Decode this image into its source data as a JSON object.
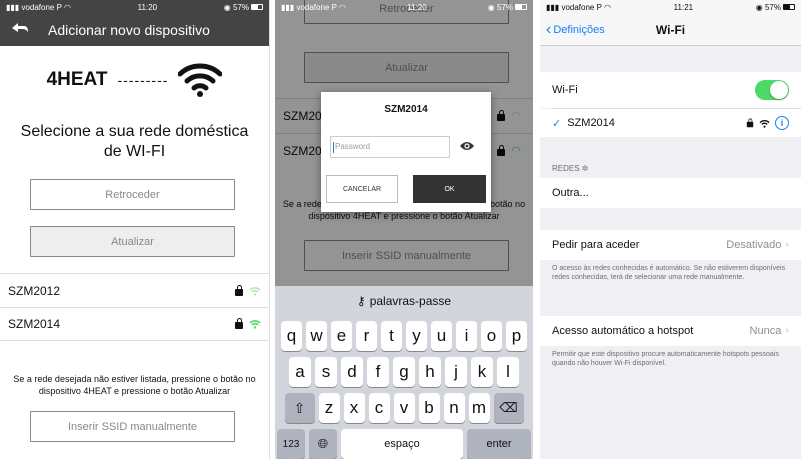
{
  "panel1": {
    "status": {
      "carrier": "vodafone P",
      "time": "11:20",
      "battery": "57%"
    },
    "header_title": "Adicionar novo dispositivo",
    "brand_name": "4HEAT",
    "brand_dashes": "---------",
    "heading": "Selecione a sua rede doméstica de WI-FI",
    "back_button": "Retroceder",
    "update_button": "Atualizar",
    "networks": [
      {
        "name": "SZM2012"
      },
      {
        "name": "SZM2014"
      }
    ],
    "note": "Se a rede desejada não estiver listada, pressione o botão no dispositivo 4HEAT e pressione o botão Atualizar",
    "manual_button": "Inserir SSID manualmente"
  },
  "panel2": {
    "status": {
      "carrier": "vodafone P",
      "time": "11:20",
      "battery": "57%"
    },
    "back_button": "Retroceder",
    "update_button": "Atualizar",
    "networks": [
      {
        "name": "SZM2012"
      },
      {
        "name": "SZM2014"
      }
    ],
    "note": "Se a rede desejada não estiver listada, pressione o botão no dispositivo 4HEAT e pressione o botão Atualizar",
    "manual_button": "Inserir SSID manualmente",
    "dialog": {
      "title": "SZM2014",
      "placeholder": "Password",
      "cancel": "CANCELAR",
      "ok": "OK"
    },
    "keyboard": {
      "suggestion": "palavras-passe",
      "row1": [
        "q",
        "w",
        "e",
        "r",
        "t",
        "y",
        "u",
        "i",
        "o",
        "p"
      ],
      "row2": [
        "a",
        "s",
        "d",
        "f",
        "g",
        "h",
        "j",
        "k",
        "l"
      ],
      "row3": [
        "z",
        "x",
        "c",
        "v",
        "b",
        "n",
        "m"
      ],
      "numbers": "123",
      "space": "espaço",
      "enter": "enter"
    }
  },
  "panel3": {
    "status": {
      "carrier": "vodafone P",
      "time": "11:21",
      "battery": "57%"
    },
    "back_label": "Definições",
    "title": "Wi-Fi",
    "wifi_label": "Wi-Fi",
    "wifi_on": true,
    "connected_network": "SZM2014",
    "networks_header": "REDES",
    "other": "Outra...",
    "ask_join_label": "Pedir para aceder",
    "ask_join_value": "Desativado",
    "ask_join_note": "O acesso às redes conhecidas é automático. Se não estiverem disponíveis redes conhecidas, terá de selecionar uma rede manualmente.",
    "hotspot_label": "Acesso automático a hotspot",
    "hotspot_value": "Nunca",
    "hotspot_note": "Permitir que este dispositivo procure automaticamente hotspots pessoais quando não houver Wi-Fi disponível."
  },
  "colors": {
    "accent_blue": "#157efb",
    "wifi_green": "#4cd964",
    "header_dark": "#444444"
  }
}
